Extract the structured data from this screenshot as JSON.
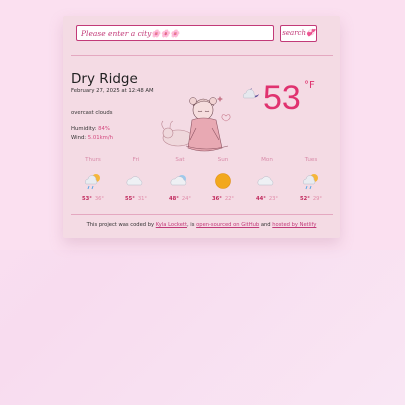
{
  "search": {
    "placeholder": "Please enter a city🌸🌸🌸",
    "button_label": "search💞"
  },
  "current": {
    "city": "Dry Ridge",
    "datetime": "February 27, 2025 at 12:48 AM",
    "description": "overcast clouds",
    "humidity_label": "Humidity:",
    "humidity_value": "84%",
    "wind_label": "Wind:",
    "wind_value": "5.01km/h",
    "temperature": "53",
    "unit": "°F",
    "icon": "cloud-moon-icon"
  },
  "forecast": [
    {
      "day": "Thurs",
      "high": "53°",
      "low": "36°",
      "icon": "rain-sun-icon"
    },
    {
      "day": "Fri",
      "high": "55°",
      "low": "31°",
      "icon": "cloud-icon"
    },
    {
      "day": "Sat",
      "high": "48°",
      "low": "24°",
      "icon": "cloud-sun-icon"
    },
    {
      "day": "Sun",
      "high": "36°",
      "low": "22°",
      "icon": "sun-icon"
    },
    {
      "day": "Mon",
      "high": "44°",
      "low": "23°",
      "icon": "cloud-icon"
    },
    {
      "day": "Tues",
      "high": "52°",
      "low": "29°",
      "icon": "rain-sun-icon"
    }
  ],
  "footer": {
    "prefix": "This project was coded by",
    "author": "Kyla Lockett",
    "middle": ", is",
    "source_link": "open-sourced on GitHub",
    "and": "and",
    "host_link": "hosted by Netlify"
  },
  "colors": {
    "accent": "#e0326f",
    "border": "#c23a78",
    "card": "#f4dbe4"
  }
}
